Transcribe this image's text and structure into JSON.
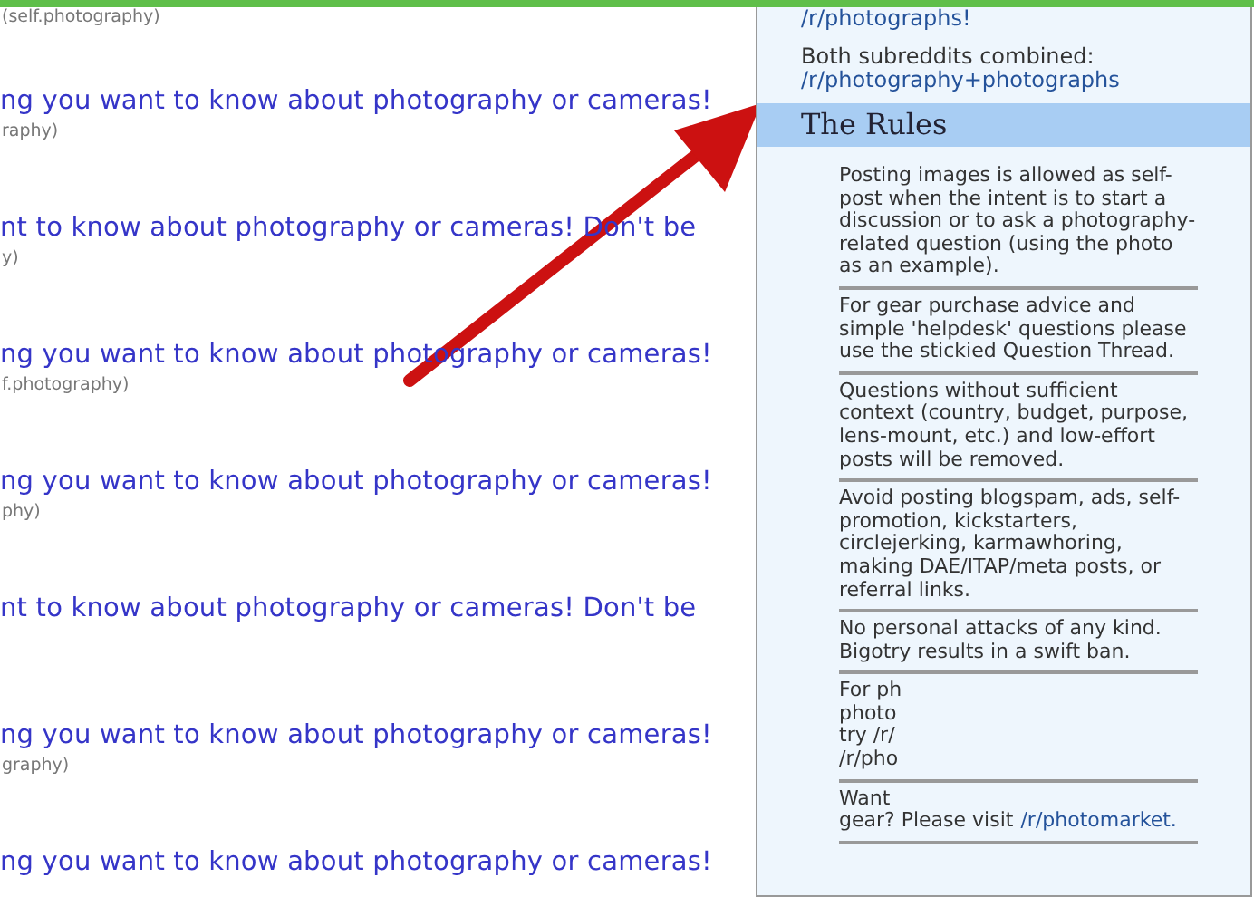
{
  "posts": [
    {
      "meta": "(self.photography)"
    },
    {
      "title": "ng you want to know about photography or cameras!",
      "meta": "raphy)"
    },
    {
      "title": "nt to know about photography or cameras! Don't be",
      "meta": "y)"
    },
    {
      "title": "ng you want to know about photography or cameras!",
      "meta": "f.photography)"
    },
    {
      "title": "ng you want to know about photography or cameras!",
      "meta": "phy)"
    },
    {
      "title": "nt to know about photography or cameras! Don't be"
    },
    {
      "title": "ng you want to know about photography or cameras!",
      "meta": "graphy)"
    },
    {
      "title": "ng you want to know about photography or cameras!"
    }
  ],
  "sidebar": {
    "top_link": "/r/photographs!",
    "combined_label": "Both subreddits combined:",
    "combined_link": "/r/photography+photographs",
    "rules_heading": "The Rules",
    "rules": [
      {
        "kind": "text",
        "text": "Posting images is allowed as self-post when the intent is to start a discussion or to ask a photography-related question (using the photo as an example)."
      },
      {
        "kind": "text",
        "text": "For gear purchase advice and simple 'helpdesk' questions please use the stickied Question Thread."
      },
      {
        "kind": "text",
        "text": "Questions without sufficient context (country, budget, purpose, lens-mount, etc.) and low-effort posts will be removed."
      },
      {
        "kind": "text",
        "text": "Avoid posting blogspam, ads, self-promotion, kickstarters, circlejerking, karmawhoring, making DAE/ITAP/meta posts, or referral links."
      },
      {
        "kind": "text",
        "text": "No personal attacks of any kind. Bigotry results in a swift ban."
      },
      {
        "kind": "lines",
        "lines": [
          "For ph",
          "photo",
          "try /r/",
          "/r/pho"
        ]
      },
      {
        "kind": "link",
        "lines": [
          "Want",
          "gear? Please visit"
        ],
        "link": "/r/photomarket."
      }
    ]
  }
}
